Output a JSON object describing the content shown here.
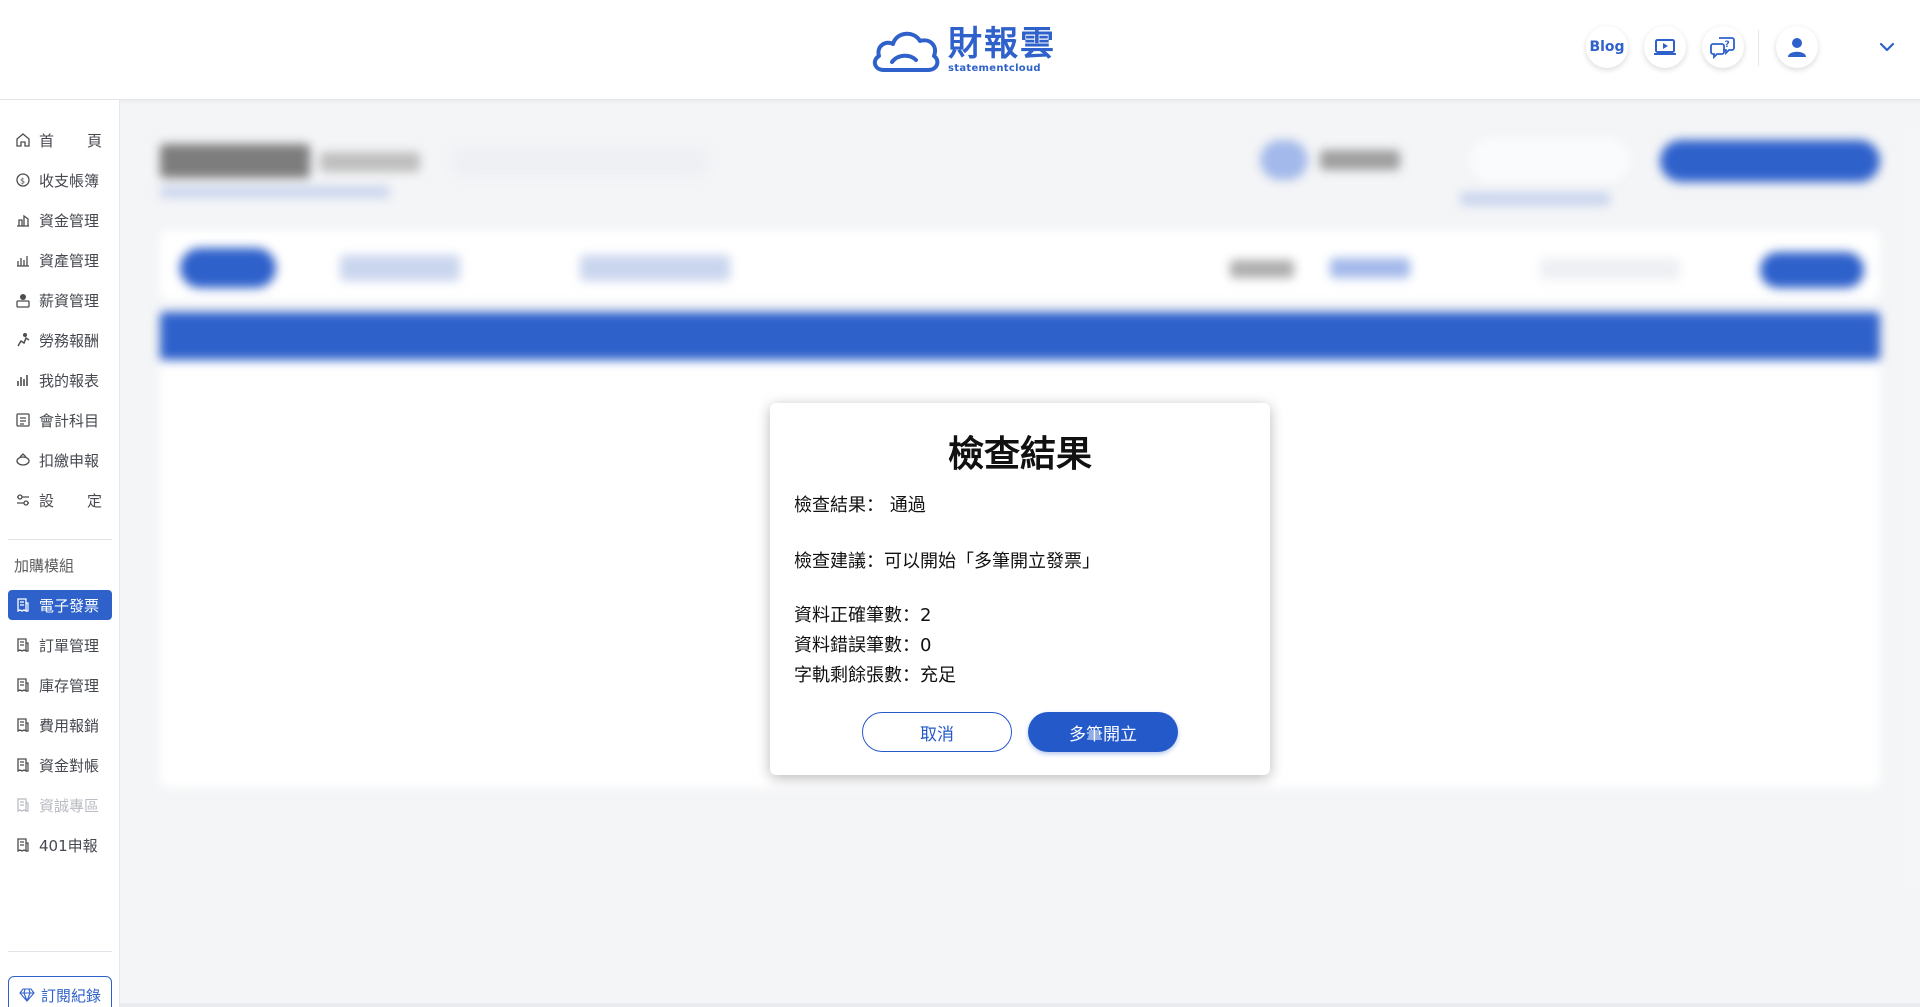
{
  "header": {
    "logo_name": "財報雲",
    "logo_sub": "statementcloud",
    "blog_label": "Blog",
    "icons": [
      "video-tutorial-icon",
      "help-chat-icon",
      "user-avatar-icon",
      "chevron-down-icon"
    ],
    "brand_color": "#2459c9"
  },
  "sidebar": {
    "main_items": [
      {
        "label": "首頁",
        "l1": "首",
        "l2": "頁",
        "icon": "home-icon"
      },
      {
        "label": "收支帳簿",
        "icon": "coin-icon"
      },
      {
        "label": "資金管理",
        "icon": "funds-icon"
      },
      {
        "label": "資產管理",
        "icon": "asset-icon"
      },
      {
        "label": "薪資管理",
        "icon": "payroll-icon"
      },
      {
        "label": "勞務報酬",
        "icon": "labor-icon"
      },
      {
        "label": "我的報表",
        "icon": "report-chart-icon"
      },
      {
        "label": "會計科目",
        "icon": "ledger-icon"
      },
      {
        "label": "扣繳申報",
        "icon": "withholding-icon"
      },
      {
        "label": "設定",
        "l1": "設",
        "l2": "定",
        "icon": "settings-sliders-icon"
      }
    ],
    "addon_heading": "加購模組",
    "addon_items": [
      {
        "label": "電子發票",
        "icon": "invoice-icon",
        "active": true
      },
      {
        "label": "訂單管理",
        "icon": "invoice-icon"
      },
      {
        "label": "庫存管理",
        "icon": "invoice-icon"
      },
      {
        "label": "費用報銷",
        "icon": "invoice-icon"
      },
      {
        "label": "資金對帳",
        "icon": "invoice-icon"
      },
      {
        "label": "資誠專區",
        "icon": "invoice-icon",
        "disabled": true
      },
      {
        "label": "401申報",
        "icon": "invoice-icon"
      }
    ],
    "subscription_label": "訂閱紀錄"
  },
  "modal": {
    "title": "檢查結果",
    "result_line": "檢查結果： 通過",
    "suggestion_line": "檢查建議：可以開始「多筆開立發票」",
    "correct_count_line": "資料正確筆數：2",
    "error_count_line": "資料錯誤筆數：0",
    "remaining_line": "字軌剩餘張數：充足",
    "cancel_label": "取消",
    "confirm_label": "多筆開立"
  }
}
